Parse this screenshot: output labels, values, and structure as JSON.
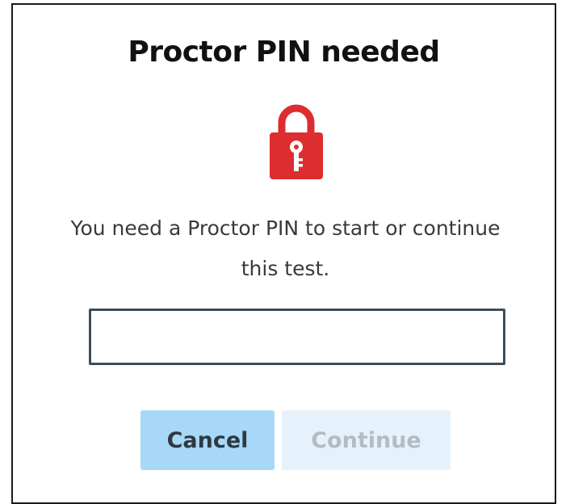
{
  "dialog": {
    "title": "Proctor PIN needed",
    "icon": "lock-key-icon",
    "icon_color": "#dd2d2f",
    "message": "You need a Proctor PIN to start or continue this test.",
    "pin_input": {
      "value": "",
      "placeholder": ""
    },
    "buttons": {
      "cancel_label": "Cancel",
      "continue_label": "Continue",
      "continue_disabled": true
    }
  }
}
